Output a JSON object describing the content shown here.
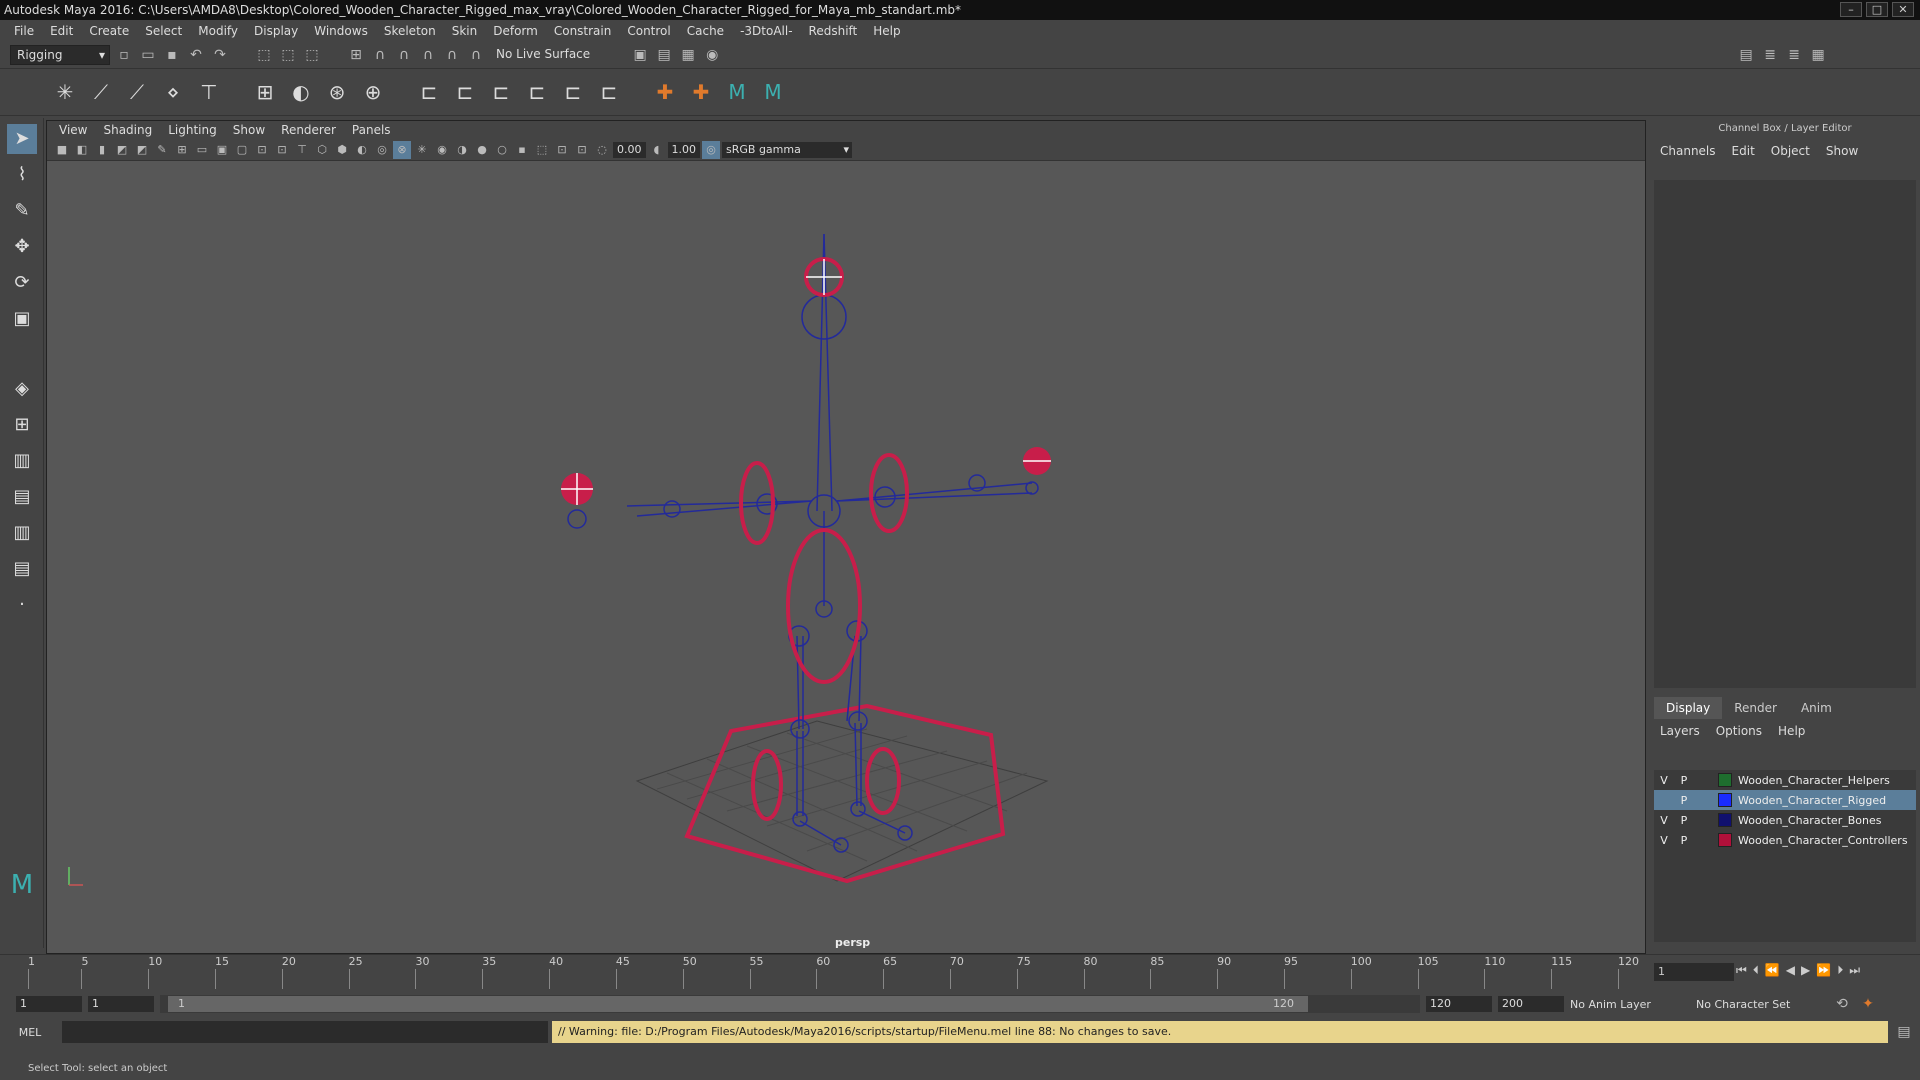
{
  "titlebar": {
    "title": "Autodesk Maya 2016: C:\\Users\\AMDA8\\Desktop\\Colored_Wooden_Character_Rigged_max_vray\\Colored_Wooden_Character_Rigged_for_Maya_mb_standart.mb*"
  },
  "menubar": {
    "items": [
      "File",
      "Edit",
      "Create",
      "Select",
      "Modify",
      "Display",
      "Windows",
      "Skeleton",
      "Skin",
      "Deform",
      "Constrain",
      "Control",
      "Cache",
      "-3DtoAll-",
      "Redshift",
      "Help"
    ]
  },
  "statusline": {
    "menuset": "Rigging",
    "live_surface": "No Live Surface"
  },
  "viewport": {
    "menu": [
      "View",
      "Shading",
      "Lighting",
      "Show",
      "Renderer",
      "Panels"
    ],
    "field_a": "0.00",
    "field_b": "1.00",
    "colorspace": "sRGB gamma",
    "camera_label": "persp"
  },
  "channelbox": {
    "header": "Channel Box / Layer Editor",
    "tabs": [
      "Channels",
      "Edit",
      "Object",
      "Show"
    ]
  },
  "layers": {
    "tabs": [
      "Display",
      "Render",
      "Anim"
    ],
    "menu": [
      "Layers",
      "Options",
      "Help"
    ],
    "rows": [
      {
        "v": "V",
        "p": "P",
        "name": "Wooden_Character_Helpers",
        "color": "#1e6e2e"
      },
      {
        "v": "",
        "p": "P",
        "name": "Wooden_Character_Rigged",
        "color": "#1a2cff"
      },
      {
        "v": "V",
        "p": "P",
        "name": "Wooden_Character_Bones",
        "color": "#10106e"
      },
      {
        "v": "V",
        "p": "P",
        "name": "Wooden_Character_Controllers",
        "color": "#b0103a"
      }
    ]
  },
  "timeline": {
    "ticks": [
      "1",
      "5",
      "10",
      "15",
      "20",
      "25",
      "30",
      "35",
      "40",
      "45",
      "50",
      "55",
      "60",
      "65",
      "70",
      "75",
      "80",
      "85",
      "90",
      "95",
      "100",
      "105",
      "110",
      "115",
      "120"
    ],
    "current_frame": "1"
  },
  "range": {
    "start": "1",
    "inner_start": "1",
    "slider_start": "1",
    "slider_end": "120",
    "end": "120",
    "outer_end": "200",
    "anim_layer": "No Anim Layer",
    "character_set": "No Character Set"
  },
  "command": {
    "lang": "MEL",
    "warning": "// Warning: file: D:/Program Files/Autodesk/Maya2016/scripts/startup/FileMenu.mel line 88: No changes to save."
  },
  "helpline": {
    "text": "Select Tool: select an object"
  }
}
